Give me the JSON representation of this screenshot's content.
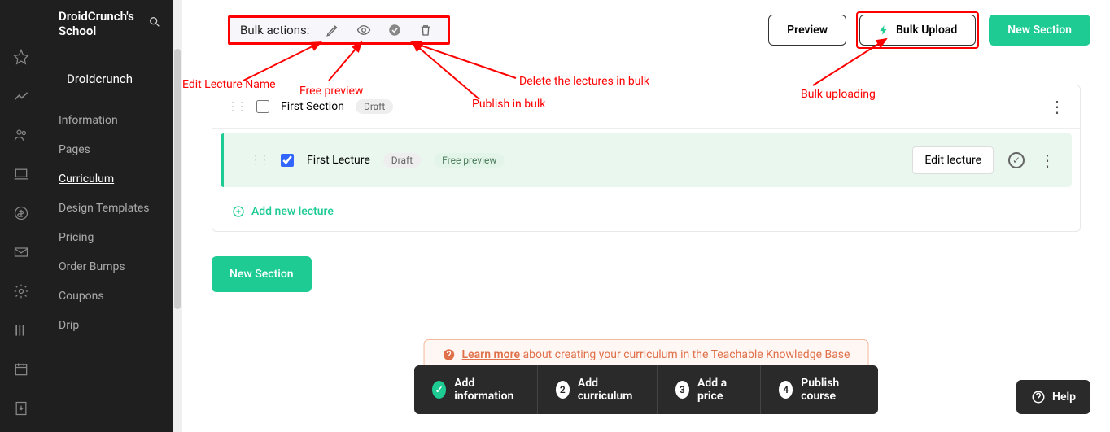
{
  "school_name": "DroidCrunch's School",
  "course_title": "Droidcrunch",
  "nav": [
    "Information",
    "Pages",
    "Curriculum",
    "Design Templates",
    "Pricing",
    "Order Bumps",
    "Coupons",
    "Drip"
  ],
  "nav_active_index": 2,
  "bulk": {
    "label": "Bulk actions:"
  },
  "buttons": {
    "preview": "Preview",
    "bulk_upload": "Bulk Upload",
    "new_section": "New Section",
    "new_section_2": "New Section",
    "edit_lecture": "Edit lecture",
    "add_lecture": "Add new lecture",
    "help": "Help"
  },
  "section": {
    "title": "First Section",
    "badge": "Draft"
  },
  "lecture": {
    "title": "First Lecture",
    "badge": "Draft",
    "badge2": "Free preview"
  },
  "banner": {
    "link": "Learn more",
    "text": " about creating your curriculum in the Teachable Knowledge Base"
  },
  "steps": [
    {
      "num": "✓",
      "label": "Add information",
      "done": true
    },
    {
      "num": "2",
      "label": "Add curriculum",
      "done": false
    },
    {
      "num": "3",
      "label": "Add a price",
      "done": false
    },
    {
      "num": "4",
      "label": "Publish course",
      "done": false
    }
  ],
  "annotations": {
    "edit": "Edit Lecture Name",
    "free": "Free preview",
    "delete": "Delete the lectures in bulk",
    "publish": "Publish in bulk",
    "bulk_up": "Bulk uploading"
  }
}
